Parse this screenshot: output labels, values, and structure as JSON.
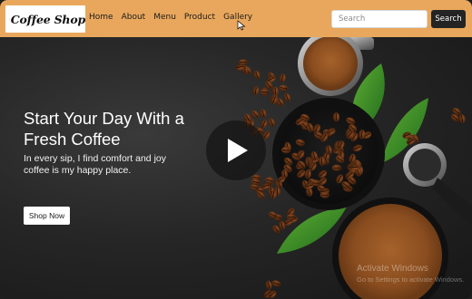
{
  "brand": {
    "name": "Coffee Shop",
    "logo_icon": "coffee-cup-icon"
  },
  "nav": {
    "links": [
      "Home",
      "About",
      "Menu",
      "Product",
      "Gallery"
    ]
  },
  "search": {
    "placeholder": "Search",
    "value": "",
    "button_label": "Search"
  },
  "hero": {
    "title": "Start Your Day With a Fresh Coffee",
    "subtitle": "In every sip, I find comfort and joy coffee is my happy place.",
    "cta_label": "Shop Now",
    "play_icon": "play-icon"
  },
  "os_watermark": {
    "title": "Activate Windows",
    "subtitle": "Go to Settings to activate Windows."
  },
  "colors": {
    "navbar": "#e8a75c",
    "background": "#262626",
    "search_button": "#242424",
    "text_light": "#ffffff"
  }
}
